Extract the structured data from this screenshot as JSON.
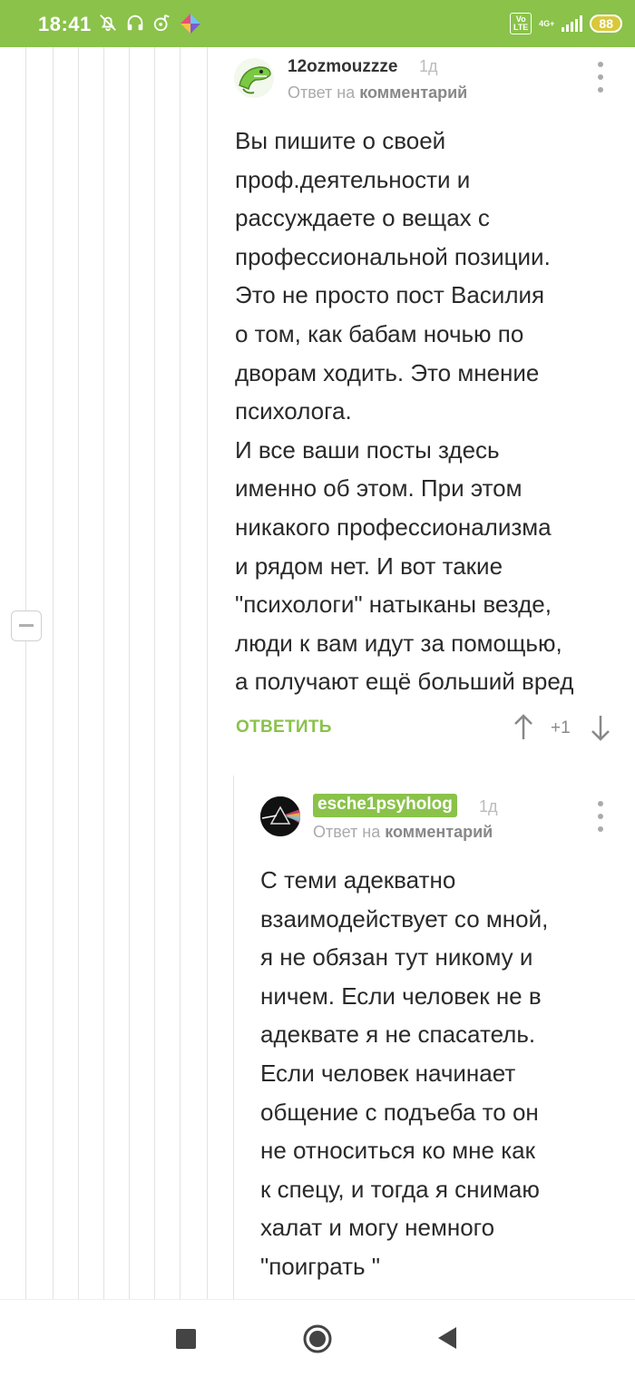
{
  "status_bar": {
    "time": "18:41",
    "icons_left": [
      "bell-off-icon",
      "headphones-icon",
      "music-note-icon",
      "app-icon"
    ],
    "volte": "Vo LTE",
    "network": "4G+",
    "battery": "88"
  },
  "comments": [
    {
      "username": "12ozmouzzze",
      "time": "1д",
      "reply_prefix": "Ответ на",
      "reply_target": "комментарий",
      "body": "Вы пишите о своей\nпроф.деятельности и\nрассуждаете о вещах с\nпрофессиональной позиции.\nЭто не просто пост Василия\nо том, как бабам ночью по\nдворам ходить. Это мнение\nпсихолога.\nИ все ваши посты здесь\nименно об этом. При этом\nникакого профессионализма\nи рядом нет. И вот такие\n\"психологи\" натыканы везде,\nлюди к вам идут за помощью,\nа получают ещё больший вред",
      "reply_label": "ОТВЕТИТЬ",
      "rating": "+1"
    },
    {
      "username": "esche1psyholog",
      "time": "1д",
      "reply_prefix": "Ответ на",
      "reply_target": "комментарий",
      "body": "С теми адекватно\nвзаимодействует со мной,\nя не обязан тут никому и\nничем. Если человек не в\nадеквате я не спасатель.\nЕсли человек начинает\nобщение с подъеба то он\nне относиться ко мне как\nк спецу, и тогда я снимаю\nхалат и могу немного\n\"поиграть \""
    }
  ],
  "colors": {
    "accent": "#8ac24a",
    "text": "#2a2a2a",
    "muted": "#aaaaaa"
  },
  "nav": {
    "recents": "square-icon",
    "home": "circle-icon",
    "back": "triangle-back-icon"
  }
}
